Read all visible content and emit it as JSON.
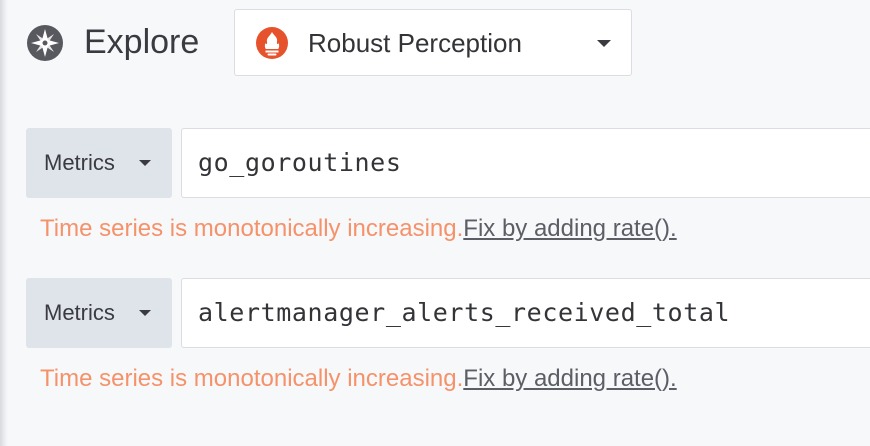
{
  "header": {
    "title": "Explore",
    "icon": "compass-icon",
    "datasource": {
      "name": "Robust Perception",
      "logo": "prometheus-logo-icon",
      "brand_color": "#e6522c"
    }
  },
  "queries": [
    {
      "selector_label": "Metrics",
      "expression": "go_goroutines",
      "hint_text": "Time series is monotonically increasing.",
      "hint_fix": "Fix by adding rate()."
    },
    {
      "selector_label": "Metrics",
      "expression": "alertmanager_alerts_received_total",
      "hint_text": "Time series is monotonically increasing.",
      "hint_fix": "Fix by adding rate()."
    }
  ],
  "colors": {
    "hint": "#f5926a",
    "link": "#5c5e66",
    "selector_bg": "#dfe3ea"
  }
}
